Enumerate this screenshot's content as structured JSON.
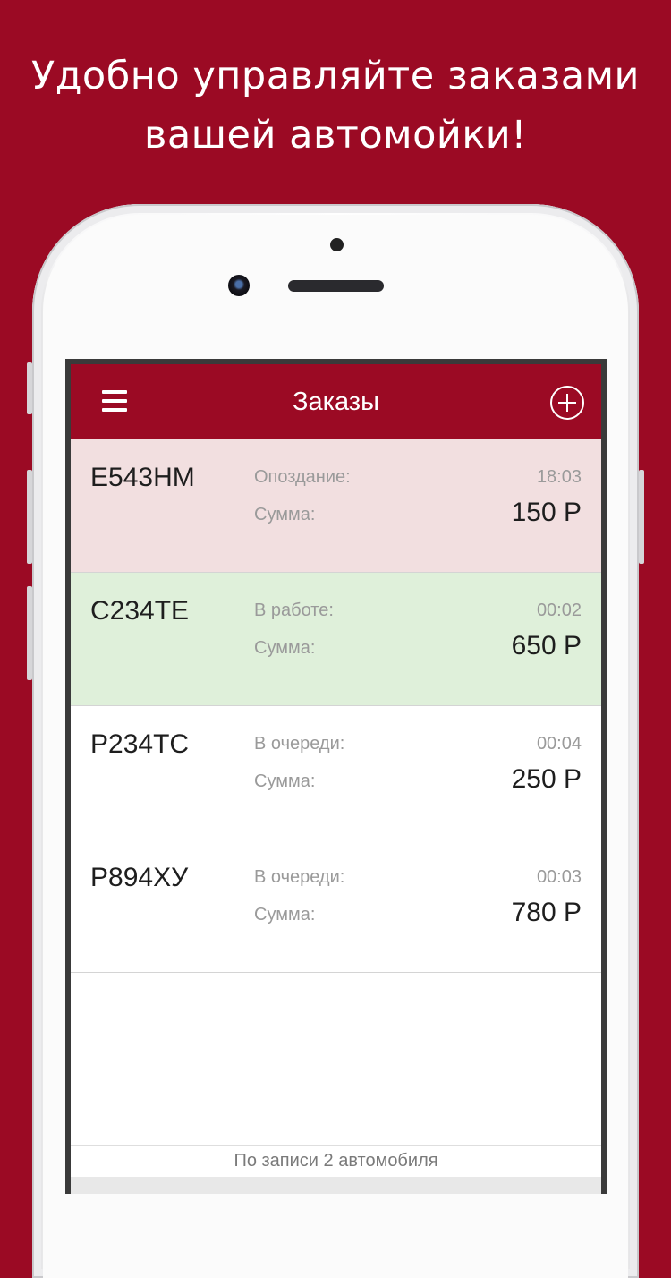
{
  "headline": {
    "line1": "Удобно управляйте заказами",
    "line2": "вашей автомойки!"
  },
  "colors": {
    "brand": "#9b0a24",
    "late_row": "#f2dfe0",
    "in_work_row": "#dff0da",
    "queued_row": "#ffffff"
  },
  "appbar": {
    "title": "Заказы",
    "menu_icon": "hamburger-icon",
    "add_icon": "plus-circle-icon"
  },
  "orders": [
    {
      "plate": "E543HM",
      "status": "Опоздание:",
      "time": "18:03",
      "sum_label": "Сумма:",
      "sum": "150 Р"
    },
    {
      "plate": "C234TE",
      "status": "В работе:",
      "time": "00:02",
      "sum_label": "Сумма:",
      "sum": "650 Р"
    },
    {
      "plate": "P234TC",
      "status": "В очереди:",
      "time": "00:04",
      "sum_label": "Сумма:",
      "sum": "250 Р"
    },
    {
      "plate": "P894XУ",
      "status": "В очереди:",
      "time": "00:03",
      "sum_label": "Сумма:",
      "sum": "780 Р"
    }
  ],
  "footer": {
    "text": "По записи 2 автомобиля"
  }
}
